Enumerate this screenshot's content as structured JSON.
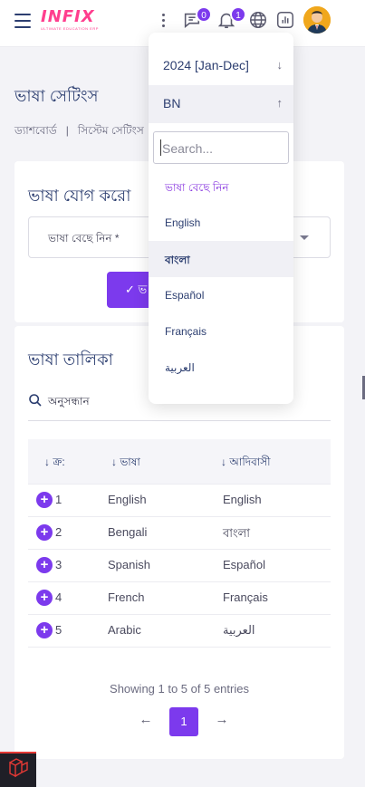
{
  "header": {
    "logo_text": "INFIX",
    "logo_tagline": "ULTIMATE EDUCATION ERP",
    "messages_badge": "0",
    "notifications_badge": "1"
  },
  "page": {
    "title": "ভাষা সেটিংস",
    "breadcrumb": [
      "ড্যাশবোর্ড",
      "সিস্টেম সেটিংস"
    ]
  },
  "add_language": {
    "title": "ভাষা যোগ করো",
    "select_placeholder": "ভাষা বেছে নিন *",
    "save_label": "✓ ভ"
  },
  "language_list": {
    "title": "ভাষা তালিকা",
    "search_placeholder": "অনুসন্ধান",
    "columns": [
      "ক্র:",
      "ভাষা",
      "আদিবাসী"
    ],
    "rows": [
      {
        "sl": "1",
        "language": "English",
        "native": "English"
      },
      {
        "sl": "2",
        "language": "Bengali",
        "native": "বাংলা"
      },
      {
        "sl": "3",
        "language": "Spanish",
        "native": "Español"
      },
      {
        "sl": "4",
        "language": "French",
        "native": "Français"
      },
      {
        "sl": "5",
        "language": "Arabic",
        "native": "العربية"
      }
    ],
    "showing": "Showing 1 to 5 of 5 entries",
    "current_page": "1",
    "prev_arrow": "←",
    "next_arrow": "→"
  },
  "dropdown": {
    "year": "2024 [Jan-Dec]",
    "language_code": "BN",
    "search_placeholder": "Search...",
    "options": [
      "ভাষা বেছে নিন",
      "English",
      "বাংলা",
      "Español",
      "Français",
      "العربية"
    ],
    "selected": "বাংলা"
  },
  "colors": {
    "accent": "#7c3aed",
    "heading": "#2c3e70",
    "logo_pink": "#ff3e8e"
  }
}
